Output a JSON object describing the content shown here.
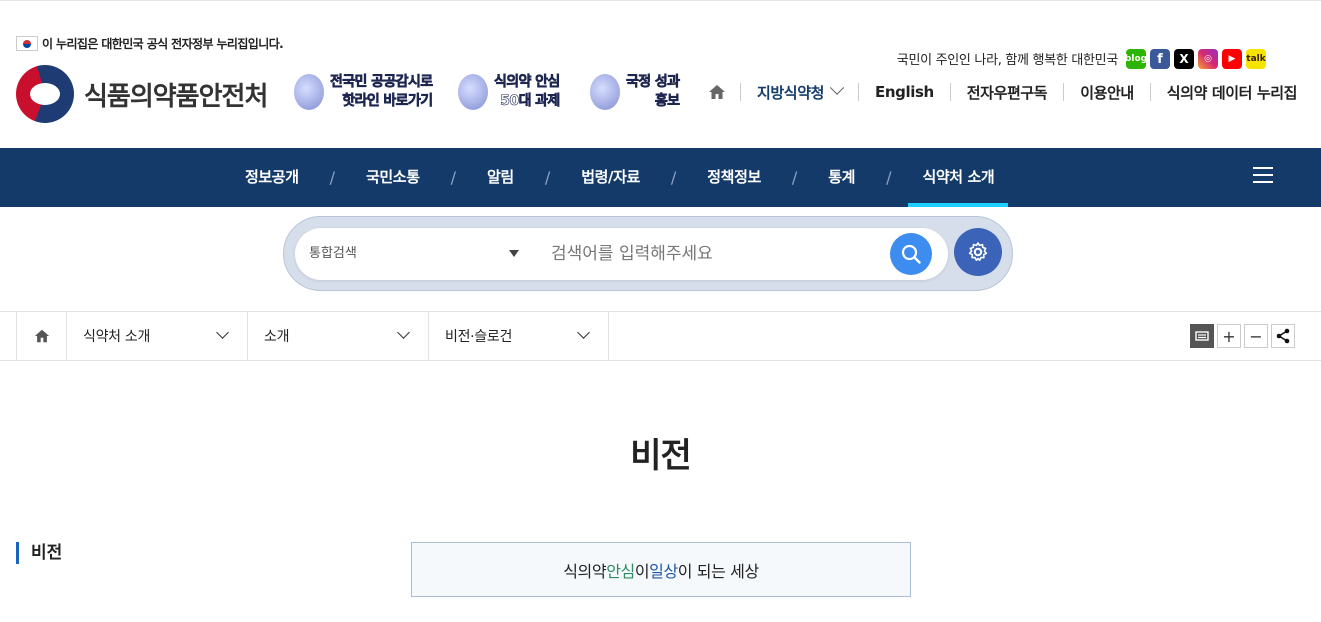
{
  "gov_notice": "이 누리집은 대한민국 공식 전자정부 누리집입니다.",
  "logo_text": "식품의약품안전처",
  "promos": [
    {
      "line1": "전국민 공공감시로",
      "line2": "핫라인 바로가기",
      "icon": "phone-icon"
    },
    {
      "line1": "식의약 안심",
      "line2": "50대 과제",
      "icon": "shield-icon"
    },
    {
      "line1": "국정 성과",
      "line2": "홍보",
      "icon": "trophy-icon"
    }
  ],
  "slogan": "국민이 주인인 나라, 함께 행복한 대한민국",
  "sns": [
    {
      "name": "blog",
      "label": "blog"
    },
    {
      "name": "facebook",
      "label": "f"
    },
    {
      "name": "x",
      "label": "X"
    },
    {
      "name": "instagram",
      "label": "◎"
    },
    {
      "name": "youtube",
      "label": "▶"
    },
    {
      "name": "kakao",
      "label": "talk"
    }
  ],
  "util": {
    "regional": "지방식약청",
    "english": "English",
    "subscribe": "전자우편구독",
    "guide": "이용안내",
    "data": "식의약 데이터 누리집"
  },
  "gnb": [
    "정보공개",
    "국민소통",
    "알림",
    "법령/자료",
    "정책정보",
    "통계",
    "식약처 소개"
  ],
  "gnb_slash": "/",
  "search": {
    "scope": "통합검색",
    "placeholder": "검색어를 입력해주세요"
  },
  "breadcrumb": [
    "식약처 소개",
    "소개",
    "비전·슬로건"
  ],
  "tools": {
    "zoom_in": "+",
    "zoom_out": "−"
  },
  "page_title": "비전",
  "section_title": "비전",
  "vision": {
    "part1": "식의약 ",
    "highlight1": "안심",
    "part2": "이 ",
    "highlight2": "일상",
    "part3": "이 되는 세상"
  },
  "colors": {
    "gnb_bg": "#133a68",
    "gnb_active": "#1fd0ff",
    "search_btn": "#3d8cf0",
    "settings_btn": "#3b63b8"
  }
}
